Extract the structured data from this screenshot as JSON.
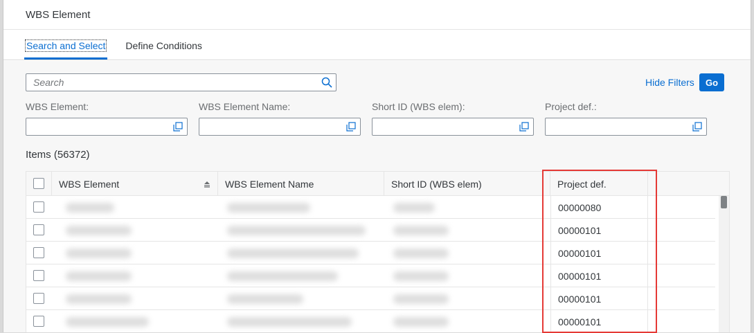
{
  "dialog": {
    "title": "WBS Element"
  },
  "tabs": [
    {
      "label": "Search and Select",
      "active": true
    },
    {
      "label": "Define Conditions",
      "active": false
    }
  ],
  "search": {
    "placeholder": "Search",
    "value": ""
  },
  "actions": {
    "hide_filters": "Hide Filters",
    "go": "Go"
  },
  "filters": [
    {
      "label": "WBS Element:",
      "value": ""
    },
    {
      "label": "WBS Element Name:",
      "value": ""
    },
    {
      "label": "Short ID (WBS elem):",
      "value": ""
    },
    {
      "label": "Project def.:",
      "value": ""
    }
  ],
  "items": {
    "title": "Items (56372)",
    "columns": [
      "WBS Element",
      "WBS Element Name",
      "Short ID (WBS elem)",
      "Project def."
    ],
    "rows": [
      {
        "project_def": "00000080"
      },
      {
        "project_def": "00000101"
      },
      {
        "project_def": "00000101"
      },
      {
        "project_def": "00000101"
      },
      {
        "project_def": "00000101"
      },
      {
        "project_def": "00000101"
      }
    ]
  },
  "colors": {
    "accent": "#0a6ed1",
    "highlight": "#e53935"
  }
}
